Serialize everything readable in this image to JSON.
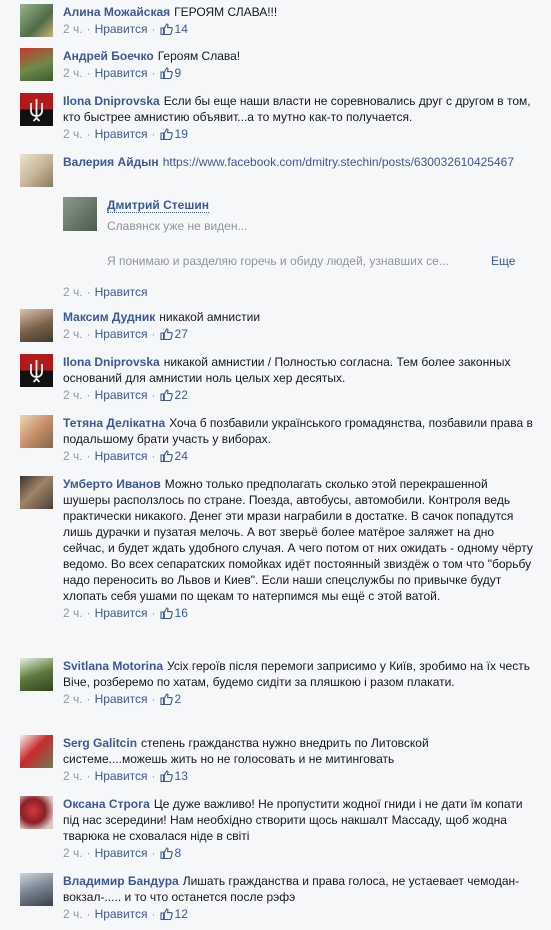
{
  "ui": {
    "time": "2 ч.",
    "like": "Нравится",
    "sep": "·"
  },
  "comments": [
    {
      "author": "Алина Можайская",
      "text": "ГЕРОЯМ СЛАВА!!!",
      "likes": "14"
    },
    {
      "author": "Андрей Боечко",
      "text": "Героям Слава!",
      "likes": "9"
    },
    {
      "author": "Ilona Dniprovska",
      "text": "Если бы еще наши власти не соревновались друг с другом в том, кто быстрее амнистию объявит...а то мутно как-то получается.",
      "likes": "19"
    },
    {
      "author": "Валерия Айдын",
      "text": "https://www.facebook.com/dmitry.stechin/posts/630032610425467",
      "likes": ""
    },
    {
      "author": "Максим Дудник",
      "text": "никакой амнистии",
      "likes": "27"
    },
    {
      "author": "Ilona Dniprovska",
      "text": "никакой амнистии / Полностью согласна. Тем более законных оснований для амнистии ноль целых хер десятых.",
      "likes": "22"
    },
    {
      "author": "Тетяна Делікатна",
      "text": "Хоча б позбавили українського громадянства, позбавили права в подальшому брати участь у виборах.",
      "likes": "24"
    },
    {
      "author": "Умберто Иванов",
      "text": "Можно только предполагать сколько этой перекрашенной шушеры расползлось по стране. Поезда, автобусы, автомобили. Контроля ведь практически никакого. Денег эти мрази награбили в достатке. В сачок попадутся лишь дурачки и пузатая мелочь. А вот зверьё более матёрое заляжет на дно сейчас, и будет ждать удобного случая. А чего потом от них ожидать - одному чёрту ведомо. Во всех сепаратских помойках идёт постоянный звиздёж о том что \"борьбу надо переносить во Львов и Киев\". Если наши спецслужбы по привычке будут хлопать себя ушами по щекам то натерпимся мы ещё с этой ватой.",
      "likes": "16"
    },
    {
      "author": "Svitlana Motorina",
      "text": "Усіх героїв після перемоги заприсимо у Київ, зробимо на їх честь Віче, розберемо по хатам, будемо сидіти за пляшкою і разом плакати.",
      "likes": "2"
    },
    {
      "author": "Serg Galitcin",
      "text": "степень гражданства нужно внедрить по Литовской системе....можешь жить но не голосовать и не митинговать",
      "likes": "13"
    },
    {
      "author": "Оксана Строга",
      "text": "Це дуже важливо! Не пропустити жодної гниди і не дати їм копати під нас зсередини! Нам необхідно створити щось накшалт Массаду, щоб жодна тварюка не сховалася ніде в світі",
      "likes": "8"
    },
    {
      "author": "Владимир Бандура",
      "text": "Лишать гражданства и права голоса, не устаевает чемодан-вокзал-..... и то что останется после рэфэ",
      "likes": "12"
    }
  ],
  "preview": {
    "title": "Дмитрий Стешин",
    "subtitle": "Славянск уже не виден...",
    "description": "Я понимаю и разделяю горечь и обиду людей, узнавших се...",
    "more": "Еще"
  },
  "colors": {
    "link": "#3b5998",
    "meta": "#9197a3",
    "text": "#141823",
    "background": "#f6f7f9"
  }
}
